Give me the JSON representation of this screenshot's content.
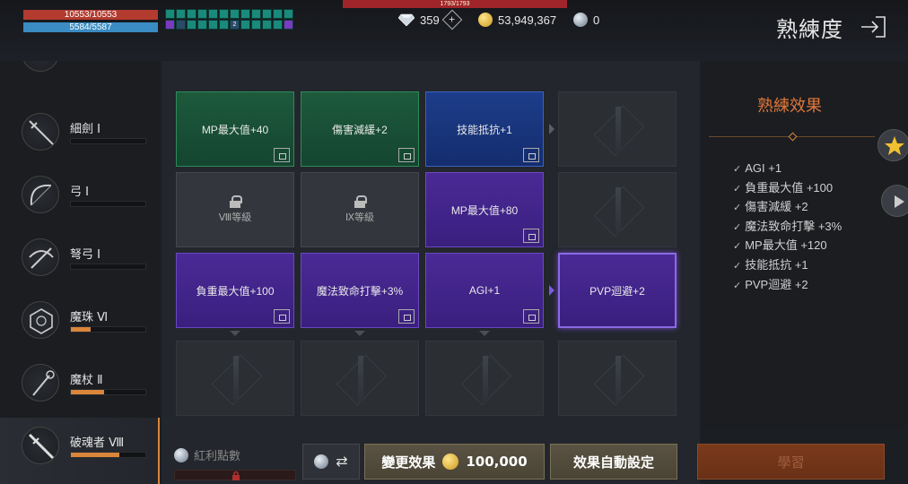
{
  "status": {
    "hp": "10553/10553",
    "mp": "5584/5587",
    "boss_hp": "1793/1793",
    "buff_count": "2"
  },
  "currency": {
    "diamonds": "359",
    "gold": "53,949,367",
    "crystal": "0"
  },
  "header": {
    "title": "熟練度"
  },
  "weapons": [
    {
      "name": "細劍 Ⅰ",
      "progress": 0
    },
    {
      "name": "弓 Ⅰ",
      "progress": 0
    },
    {
      "name": "弩弓 Ⅰ",
      "progress": 0
    },
    {
      "name": "魔珠 Ⅵ",
      "progress": 0.27
    },
    {
      "name": "魔杖 Ⅱ",
      "progress": 0.45
    },
    {
      "name": "破魂者 Ⅷ",
      "progress": 0.65
    }
  ],
  "grid": {
    "row1": [
      "MP最大值+40",
      "傷害減緩+2",
      "技能抵抗+1",
      ""
    ],
    "row2": [
      "Ⅷ等級",
      "Ⅸ等級",
      "MP最大值+80",
      ""
    ],
    "row3": [
      "負重最大值+100",
      "魔法致命打擊+3%",
      "AGI+1",
      "PVP迴避+2"
    ]
  },
  "effects": {
    "title": "熟練效果",
    "items": [
      "AGI +1",
      "負重最大值 +100",
      "傷害減緩 +2",
      "魔法致命打擊 +3%",
      "MP最大值 +120",
      "技能抵抗 +1",
      "PVP迴避 +2"
    ]
  },
  "bottom": {
    "bonus_label": "紅利點數",
    "change_label": "變更效果",
    "change_cost": "100,000",
    "auto_label": "效果自動設定",
    "learn_label": "學習"
  },
  "colors": {
    "accent": "#e0773a",
    "hp": "#b33a2e",
    "mp": "#3a8cc2",
    "green_cell": "#1d5a3c",
    "blue_cell": "#1d3d8a",
    "purple_cell": "#4a2a96"
  }
}
